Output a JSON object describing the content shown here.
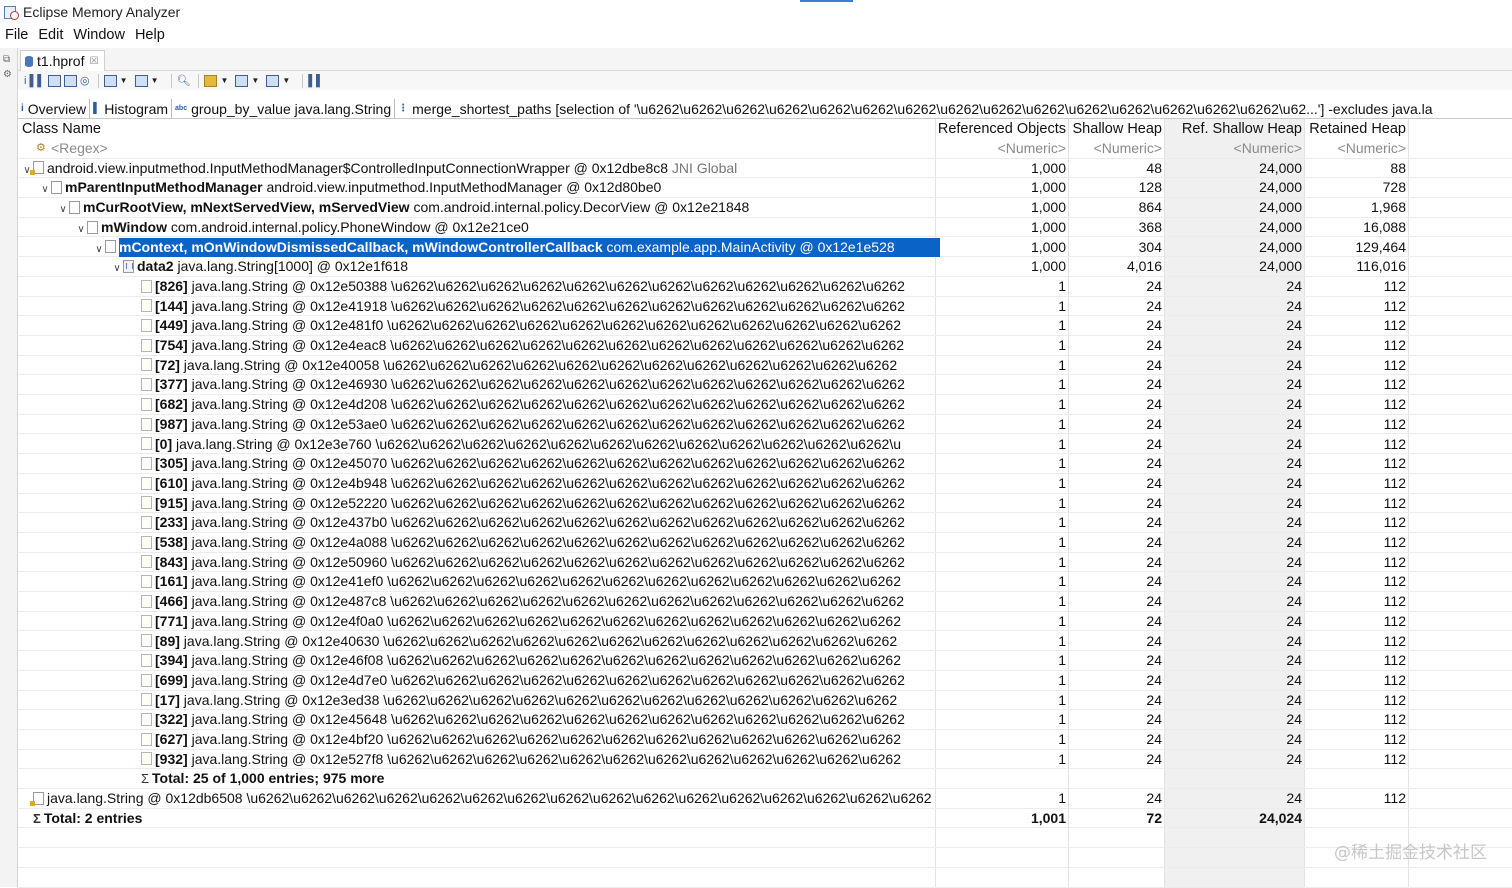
{
  "window": {
    "title": "Eclipse Memory Analyzer"
  },
  "menu": [
    "File",
    "Edit",
    "Window",
    "Help"
  ],
  "editor_tab": {
    "label": "t1.hprof",
    "close": "☒"
  },
  "subtabs": [
    {
      "icon": "i",
      "label": "Overview"
    },
    {
      "icon": "▌",
      "label": "Histogram"
    },
    {
      "icon": "abc",
      "label": "group_by_value  java.lang.String"
    },
    {
      "icon": "⋮",
      "label": "merge_shortest_paths  [selection of '\\u6262\\u6262\\u6262\\u6262\\u6262\\u6262\\u6262\\u6262\\u6262\\u6262\\u6262\\u6262\\u6262\\u6262\\u6262\\u62...'] -excludes java.la"
    }
  ],
  "columns": [
    {
      "label": "Class Name",
      "filter": "<Regex>"
    },
    {
      "label": "Referenced Objects",
      "filter": "<Numeric>"
    },
    {
      "label": "Shallow Heap",
      "filter": "<Numeric>"
    },
    {
      "label": "Ref. Shallow Heap",
      "filter": "<Numeric>"
    },
    {
      "label": "Retained Heap",
      "filter": "<Numeric>"
    }
  ],
  "rows": [
    {
      "level": 0,
      "toggle": "∨",
      "icon": "objg",
      "bold": "",
      "text": "android.view.inputmethod.InputMethodManager$ControlledInputConnectionWrapper @ 0x12dbe8c8",
      "tag": "JNI Global",
      "ref": "1,000",
      "shallow": "48",
      "refshallow": "24,000",
      "retained": "88"
    },
    {
      "level": 1,
      "toggle": "∨",
      "icon": "obj",
      "bold": "mParentInputMethodManager",
      "text": "android.view.inputmethod.InputMethodManager @ 0x12d80be0",
      "tag": "",
      "ref": "1,000",
      "shallow": "128",
      "refshallow": "24,000",
      "retained": "728"
    },
    {
      "level": 2,
      "toggle": "∨",
      "icon": "obj",
      "bold": "mCurRootView, mNextServedView, mServedView",
      "text": "com.android.internal.policy.DecorView @ 0x12e21848",
      "tag": "",
      "ref": "1,000",
      "shallow": "864",
      "refshallow": "24,000",
      "retained": "1,968"
    },
    {
      "level": 3,
      "toggle": "∨",
      "icon": "obj",
      "bold": "mWindow",
      "text": "com.android.internal.policy.PhoneWindow @ 0x12e21ce0",
      "tag": "",
      "ref": "1,000",
      "shallow": "368",
      "refshallow": "24,000",
      "retained": "16,088"
    },
    {
      "level": 4,
      "toggle": "∨",
      "icon": "obj",
      "bold": "mContext, mOnWindowDismissedCallback, mWindowControllerCallback",
      "text": "com.example.app.MainActivity @ 0x12e1e528",
      "tag": "",
      "ref": "1,000",
      "shallow": "304",
      "refshallow": "24,000",
      "retained": "129,464",
      "selected": true
    },
    {
      "level": 5,
      "toggle": "∨",
      "icon": "arr",
      "bold": "data2",
      "text": "java.lang.String[1000] @ 0x12e1f618",
      "tag": "",
      "ref": "1,000",
      "shallow": "4,016",
      "refshallow": "24,000",
      "retained": "116,016"
    },
    {
      "level": 6,
      "toggle": "",
      "icon": "leaf",
      "bold": "[826]",
      "text": "java.lang.String @ 0x12e50388  \\u6262\\u6262\\u6262\\u6262\\u6262\\u6262\\u6262\\u6262\\u6262\\u6262\\u6262\\u6262",
      "tag": "",
      "ref": "1",
      "shallow": "24",
      "refshallow": "24",
      "retained": "112"
    },
    {
      "level": 6,
      "toggle": "",
      "icon": "leaf",
      "bold": "[144]",
      "text": "java.lang.String @ 0x12e41918  \\u6262\\u6262\\u6262\\u6262\\u6262\\u6262\\u6262\\u6262\\u6262\\u6262\\u6262\\u6262",
      "tag": "",
      "ref": "1",
      "shallow": "24",
      "refshallow": "24",
      "retained": "112"
    },
    {
      "level": 6,
      "toggle": "",
      "icon": "leaf",
      "bold": "[449]",
      "text": "java.lang.String @ 0x12e481f0  \\u6262\\u6262\\u6262\\u6262\\u6262\\u6262\\u6262\\u6262\\u6262\\u6262\\u6262\\u6262",
      "tag": "",
      "ref": "1",
      "shallow": "24",
      "refshallow": "24",
      "retained": "112"
    },
    {
      "level": 6,
      "toggle": "",
      "icon": "leaf",
      "bold": "[754]",
      "text": "java.lang.String @ 0x12e4eac8  \\u6262\\u6262\\u6262\\u6262\\u6262\\u6262\\u6262\\u6262\\u6262\\u6262\\u6262\\u6262",
      "tag": "",
      "ref": "1",
      "shallow": "24",
      "refshallow": "24",
      "retained": "112"
    },
    {
      "level": 6,
      "toggle": "",
      "icon": "leaf",
      "bold": "[72]",
      "text": "java.lang.String @ 0x12e40058  \\u6262\\u6262\\u6262\\u6262\\u6262\\u6262\\u6262\\u6262\\u6262\\u6262\\u6262\\u6262",
      "tag": "",
      "ref": "1",
      "shallow": "24",
      "refshallow": "24",
      "retained": "112"
    },
    {
      "level": 6,
      "toggle": "",
      "icon": "leaf",
      "bold": "[377]",
      "text": "java.lang.String @ 0x12e46930  \\u6262\\u6262\\u6262\\u6262\\u6262\\u6262\\u6262\\u6262\\u6262\\u6262\\u6262\\u6262",
      "tag": "",
      "ref": "1",
      "shallow": "24",
      "refshallow": "24",
      "retained": "112"
    },
    {
      "level": 6,
      "toggle": "",
      "icon": "leaf",
      "bold": "[682]",
      "text": "java.lang.String @ 0x12e4d208  \\u6262\\u6262\\u6262\\u6262\\u6262\\u6262\\u6262\\u6262\\u6262\\u6262\\u6262\\u6262",
      "tag": "",
      "ref": "1",
      "shallow": "24",
      "refshallow": "24",
      "retained": "112"
    },
    {
      "level": 6,
      "toggle": "",
      "icon": "leaf",
      "bold": "[987]",
      "text": "java.lang.String @ 0x12e53ae0  \\u6262\\u6262\\u6262\\u6262\\u6262\\u6262\\u6262\\u6262\\u6262\\u6262\\u6262\\u6262",
      "tag": "",
      "ref": "1",
      "shallow": "24",
      "refshallow": "24",
      "retained": "112"
    },
    {
      "level": 6,
      "toggle": "",
      "icon": "leaf",
      "bold": "[0]",
      "text": "java.lang.String @ 0x12e3e760  \\u6262\\u6262\\u6262\\u6262\\u6262\\u6262\\u6262\\u6262\\u6262\\u6262\\u6262\\u6262\\u",
      "tag": "",
      "ref": "1",
      "shallow": "24",
      "refshallow": "24",
      "retained": "112"
    },
    {
      "level": 6,
      "toggle": "",
      "icon": "leaf",
      "bold": "[305]",
      "text": "java.lang.String @ 0x12e45070  \\u6262\\u6262\\u6262\\u6262\\u6262\\u6262\\u6262\\u6262\\u6262\\u6262\\u6262\\u6262",
      "tag": "",
      "ref": "1",
      "shallow": "24",
      "refshallow": "24",
      "retained": "112"
    },
    {
      "level": 6,
      "toggle": "",
      "icon": "leaf",
      "bold": "[610]",
      "text": "java.lang.String @ 0x12e4b948  \\u6262\\u6262\\u6262\\u6262\\u6262\\u6262\\u6262\\u6262\\u6262\\u6262\\u6262\\u6262",
      "tag": "",
      "ref": "1",
      "shallow": "24",
      "refshallow": "24",
      "retained": "112"
    },
    {
      "level": 6,
      "toggle": "",
      "icon": "leaf",
      "bold": "[915]",
      "text": "java.lang.String @ 0x12e52220  \\u6262\\u6262\\u6262\\u6262\\u6262\\u6262\\u6262\\u6262\\u6262\\u6262\\u6262\\u6262",
      "tag": "",
      "ref": "1",
      "shallow": "24",
      "refshallow": "24",
      "retained": "112"
    },
    {
      "level": 6,
      "toggle": "",
      "icon": "leaf",
      "bold": "[233]",
      "text": "java.lang.String @ 0x12e437b0  \\u6262\\u6262\\u6262\\u6262\\u6262\\u6262\\u6262\\u6262\\u6262\\u6262\\u6262\\u6262",
      "tag": "",
      "ref": "1",
      "shallow": "24",
      "refshallow": "24",
      "retained": "112"
    },
    {
      "level": 6,
      "toggle": "",
      "icon": "leaf",
      "bold": "[538]",
      "text": "java.lang.String @ 0x12e4a088  \\u6262\\u6262\\u6262\\u6262\\u6262\\u6262\\u6262\\u6262\\u6262\\u6262\\u6262\\u6262",
      "tag": "",
      "ref": "1",
      "shallow": "24",
      "refshallow": "24",
      "retained": "112"
    },
    {
      "level": 6,
      "toggle": "",
      "icon": "leaf",
      "bold": "[843]",
      "text": "java.lang.String @ 0x12e50960  \\u6262\\u6262\\u6262\\u6262\\u6262\\u6262\\u6262\\u6262\\u6262\\u6262\\u6262\\u6262",
      "tag": "",
      "ref": "1",
      "shallow": "24",
      "refshallow": "24",
      "retained": "112"
    },
    {
      "level": 6,
      "toggle": "",
      "icon": "leaf",
      "bold": "[161]",
      "text": "java.lang.String @ 0x12e41ef0  \\u6262\\u6262\\u6262\\u6262\\u6262\\u6262\\u6262\\u6262\\u6262\\u6262\\u6262\\u6262",
      "tag": "",
      "ref": "1",
      "shallow": "24",
      "refshallow": "24",
      "retained": "112"
    },
    {
      "level": 6,
      "toggle": "",
      "icon": "leaf",
      "bold": "[466]",
      "text": "java.lang.String @ 0x12e487c8  \\u6262\\u6262\\u6262\\u6262\\u6262\\u6262\\u6262\\u6262\\u6262\\u6262\\u6262\\u6262",
      "tag": "",
      "ref": "1",
      "shallow": "24",
      "refshallow": "24",
      "retained": "112"
    },
    {
      "level": 6,
      "toggle": "",
      "icon": "leaf",
      "bold": "[771]",
      "text": "java.lang.String @ 0x12e4f0a0  \\u6262\\u6262\\u6262\\u6262\\u6262\\u6262\\u6262\\u6262\\u6262\\u6262\\u6262\\u6262",
      "tag": "",
      "ref": "1",
      "shallow": "24",
      "refshallow": "24",
      "retained": "112"
    },
    {
      "level": 6,
      "toggle": "",
      "icon": "leaf",
      "bold": "[89]",
      "text": "java.lang.String @ 0x12e40630  \\u6262\\u6262\\u6262\\u6262\\u6262\\u6262\\u6262\\u6262\\u6262\\u6262\\u6262\\u6262",
      "tag": "",
      "ref": "1",
      "shallow": "24",
      "refshallow": "24",
      "retained": "112"
    },
    {
      "level": 6,
      "toggle": "",
      "icon": "leaf",
      "bold": "[394]",
      "text": "java.lang.String @ 0x12e46f08  \\u6262\\u6262\\u6262\\u6262\\u6262\\u6262\\u6262\\u6262\\u6262\\u6262\\u6262\\u6262",
      "tag": "",
      "ref": "1",
      "shallow": "24",
      "refshallow": "24",
      "retained": "112"
    },
    {
      "level": 6,
      "toggle": "",
      "icon": "leaf",
      "bold": "[699]",
      "text": "java.lang.String @ 0x12e4d7e0  \\u6262\\u6262\\u6262\\u6262\\u6262\\u6262\\u6262\\u6262\\u6262\\u6262\\u6262\\u6262",
      "tag": "",
      "ref": "1",
      "shallow": "24",
      "refshallow": "24",
      "retained": "112"
    },
    {
      "level": 6,
      "toggle": "",
      "icon": "leaf",
      "bold": "[17]",
      "text": "java.lang.String @ 0x12e3ed38  \\u6262\\u6262\\u6262\\u6262\\u6262\\u6262\\u6262\\u6262\\u6262\\u6262\\u6262\\u6262",
      "tag": "",
      "ref": "1",
      "shallow": "24",
      "refshallow": "24",
      "retained": "112"
    },
    {
      "level": 6,
      "toggle": "",
      "icon": "leaf",
      "bold": "[322]",
      "text": "java.lang.String @ 0x12e45648  \\u6262\\u6262\\u6262\\u6262\\u6262\\u6262\\u6262\\u6262\\u6262\\u6262\\u6262\\u6262",
      "tag": "",
      "ref": "1",
      "shallow": "24",
      "refshallow": "24",
      "retained": "112"
    },
    {
      "level": 6,
      "toggle": "",
      "icon": "leaf",
      "bold": "[627]",
      "text": "java.lang.String @ 0x12e4bf20  \\u6262\\u6262\\u6262\\u6262\\u6262\\u6262\\u6262\\u6262\\u6262\\u6262\\u6262\\u6262",
      "tag": "",
      "ref": "1",
      "shallow": "24",
      "refshallow": "24",
      "retained": "112"
    },
    {
      "level": 6,
      "toggle": "",
      "icon": "leaf",
      "bold": "[932]",
      "text": "java.lang.String @ 0x12e527f8  \\u6262\\u6262\\u6262\\u6262\\u6262\\u6262\\u6262\\u6262\\u6262\\u6262\\u6262\\u6262",
      "tag": "",
      "ref": "1",
      "shallow": "24",
      "refshallow": "24",
      "retained": "112"
    },
    {
      "level": 6,
      "toggle": "",
      "icon": "sigma",
      "bold": "Total: 25 of 1,000 entries; 975 more",
      "text": "",
      "tag": "",
      "ref": "",
      "shallow": "",
      "refshallow": "",
      "retained": ""
    },
    {
      "level": 0,
      "toggle": "",
      "icon": "objg",
      "bold": "",
      "text": "java.lang.String @ 0x12db6508  \\u6262\\u6262\\u6262\\u6262\\u6262\\u6262\\u6262\\u6262\\u6262\\u6262\\u6262\\u6262\\u6262\\u6262\\u6262\\u6262",
      "tag": "",
      "ref": "1",
      "shallow": "24",
      "refshallow": "24",
      "retained": "112"
    },
    {
      "level": 0,
      "toggle": "",
      "icon": "sigma",
      "bold": "Total: 2 entries",
      "text": "",
      "tag": "",
      "ref": "1,001",
      "shallow": "72",
      "refshallow": "24,024",
      "retained": "",
      "total": true
    }
  ],
  "watermark": "@稀土掘金技术社区"
}
